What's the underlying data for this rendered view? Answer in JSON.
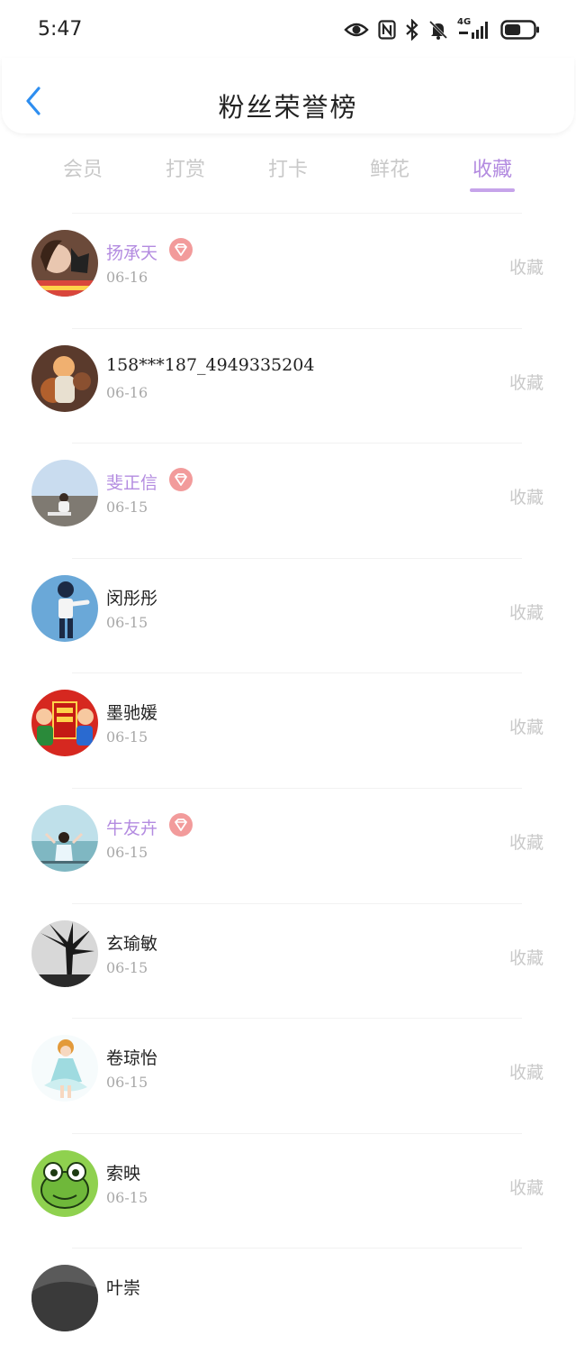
{
  "status_bar": {
    "time": "5:47",
    "network": "4G",
    "battery_level": 0.55,
    "icons": [
      "eye-icon",
      "nfc-icon",
      "bluetooth-icon",
      "bell-muted-icon",
      "signal-icon",
      "battery-icon"
    ]
  },
  "header": {
    "title": "粉丝荣誉榜",
    "back_icon": "chevron-left-icon",
    "accent": "#2e8ef0"
  },
  "tabs": [
    {
      "label": "会员",
      "active": false
    },
    {
      "label": "打赏",
      "active": false
    },
    {
      "label": "打卡",
      "active": false
    },
    {
      "label": "鲜花",
      "active": false
    },
    {
      "label": "收藏",
      "active": true
    }
  ],
  "colors": {
    "active_tab": "#b38be0",
    "vip_name": "#b38be0",
    "vip_badge": "#f29b9b",
    "muted": "#c9c9c9"
  },
  "fans": [
    {
      "name": "扬承天",
      "vip": true,
      "date": "06-16",
      "action": "收藏"
    },
    {
      "name": "158***187_4949335204",
      "vip": false,
      "date": "06-16",
      "action": "收藏"
    },
    {
      "name": "斐正信",
      "vip": true,
      "date": "06-15",
      "action": "收藏"
    },
    {
      "name": "闵彤彤",
      "vip": false,
      "date": "06-15",
      "action": "收藏"
    },
    {
      "name": "墨驰媛",
      "vip": false,
      "date": "06-15",
      "action": "收藏"
    },
    {
      "name": "牛友卉",
      "vip": true,
      "date": "06-15",
      "action": "收藏"
    },
    {
      "name": "玄瑜敏",
      "vip": false,
      "date": "06-15",
      "action": "收藏"
    },
    {
      "name": "卷琼怡",
      "vip": false,
      "date": "06-15",
      "action": "收藏"
    },
    {
      "name": "索映",
      "vip": false,
      "date": "06-15",
      "action": "收藏"
    },
    {
      "name": "叶崇",
      "vip": false,
      "date": "",
      "action": ""
    }
  ]
}
